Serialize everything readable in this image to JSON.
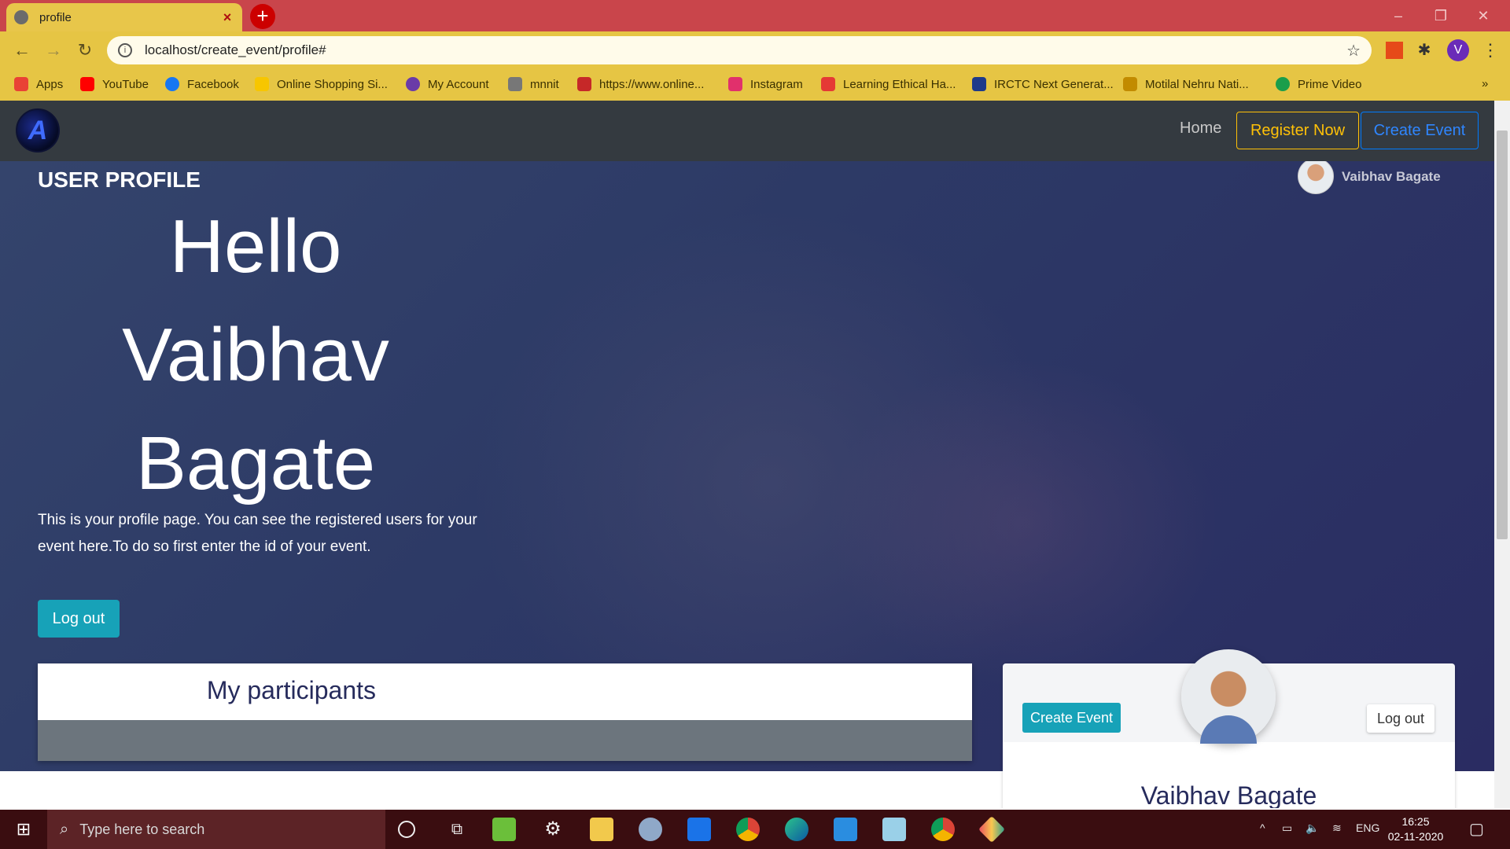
{
  "browser": {
    "tab_title": "profile",
    "url": "localhost/create_event/profile#",
    "profile_initial": "V",
    "bookmarks": [
      {
        "label": "Apps",
        "color": "#e94235"
      },
      {
        "label": "YouTube",
        "color": "#ff0000"
      },
      {
        "label": "Facebook",
        "color": "#1877f2"
      },
      {
        "label": "Online Shopping Si...",
        "color": "#f7c600"
      },
      {
        "label": "My Account",
        "color": "#6a3ba8"
      },
      {
        "label": "mnnit",
        "color": "#777777"
      },
      {
        "label": "https://www.online...",
        "color": "#c62828"
      },
      {
        "label": "Instagram",
        "color": "#e1306c"
      },
      {
        "label": "Learning Ethical Ha...",
        "color": "#e53935"
      },
      {
        "label": "IRCTC Next Generat...",
        "color": "#1e3a8a"
      },
      {
        "label": "Motilal Nehru Nati...",
        "color": "#c28b00"
      },
      {
        "label": "Prime Video",
        "color": "#1b9e4b"
      }
    ],
    "more_bookmarks": "»"
  },
  "site": {
    "nav": {
      "home": "Home",
      "register": "Register Now",
      "create_event": "Create Event"
    },
    "hero": {
      "section_title": "USER PROFILE",
      "greeting_lines": [
        "Hello",
        "Vaibhav",
        "Bagate"
      ],
      "description": "This is your profile page. You can see the registered users for your event here.To do so first enter the id of your event.",
      "logout": "Log out",
      "username": "Vaibhav Bagate"
    },
    "participants": {
      "title": "My participants"
    },
    "profile_card": {
      "create_event": "Create Event",
      "logout": "Log out",
      "name": "Vaibhav Bagate"
    }
  },
  "taskbar": {
    "search_placeholder": "Type here to search",
    "language": "ENG",
    "time": "16:25",
    "date": "02-11-2020"
  },
  "colors": {
    "navbar": "#343a40",
    "accent_info": "#17a2b8",
    "warning": "#ffc107",
    "primary": "#007bff"
  }
}
